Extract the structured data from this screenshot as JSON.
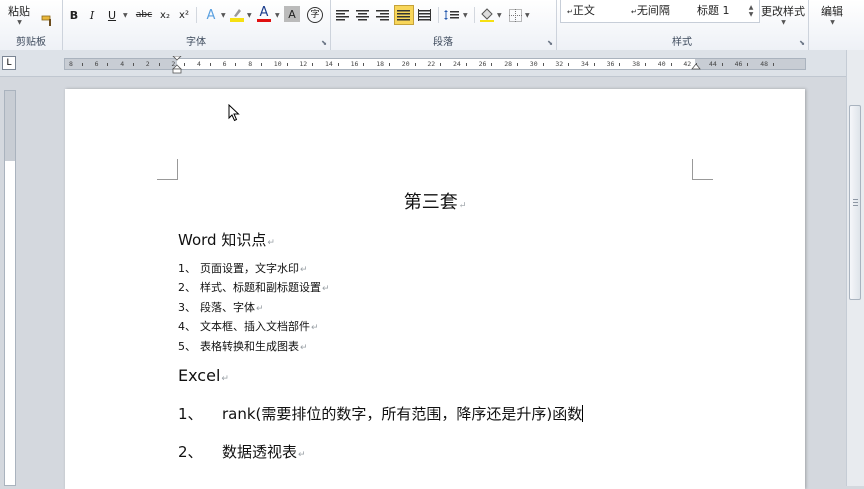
{
  "ribbon": {
    "paste_label": "粘贴",
    "groups": {
      "clipboard": "剪贴板",
      "font": "字体",
      "paragraph": "段落",
      "styles": "样式"
    },
    "styles_gallery": [
      "正文",
      "无间隔",
      "标题 1"
    ],
    "change_styles_label": "更改样式",
    "edit_label": "编辑",
    "font_buttons": [
      "B",
      "I",
      "U",
      "abc",
      "x₂",
      "x²",
      "A",
      "A",
      "A",
      "字"
    ],
    "highlight_color": "#f6e012",
    "font_color": "#e01010",
    "justify_active_color": "#f8d65a"
  },
  "ruler": {
    "numbers": [
      "8",
      "6",
      "4",
      "2",
      "2",
      "4",
      "6",
      "8",
      "10",
      "12",
      "14",
      "16",
      "18",
      "20",
      "22",
      "24",
      "26",
      "28",
      "30",
      "32",
      "34",
      "36",
      "38",
      "40",
      "42",
      "44",
      "46",
      "48"
    ]
  },
  "document": {
    "title": "第三套",
    "section1_heading": "Word 知识点",
    "word_items": [
      {
        "num": "1、",
        "text": "页面设置，文字水印"
      },
      {
        "num": "2、",
        "text": "样式、标题和副标题设置"
      },
      {
        "num": "3、",
        "text": "段落、字体"
      },
      {
        "num": "4、",
        "text": "文本框、插入文档部件"
      },
      {
        "num": "5、",
        "text": "表格转换和生成图表"
      }
    ],
    "section2_heading": "Excel",
    "excel_items": [
      {
        "num": "1、",
        "text": "rank(需要排位的数字，所有范围，降序还是升序)函数"
      },
      {
        "num": "2、",
        "text": "数据透视表"
      }
    ],
    "paragraph_mark": "↵"
  }
}
